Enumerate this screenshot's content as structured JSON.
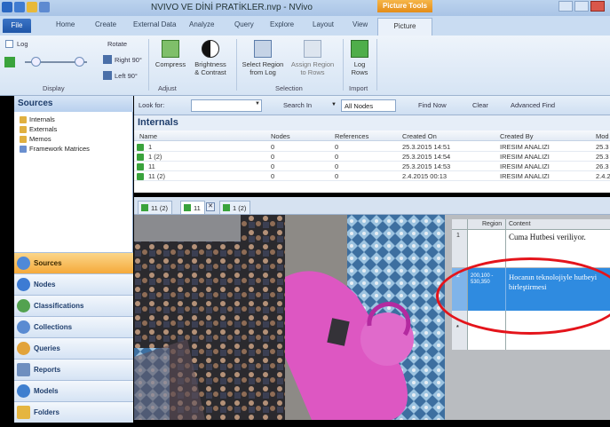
{
  "window": {
    "title": "NVIVO VE DİNİ PRATİKLER.nvp - NVivo",
    "contextual_tab": "Picture Tools"
  },
  "ribbon_tabs": [
    "File",
    "Home",
    "Create",
    "External Data",
    "Analyze",
    "Query",
    "Explore",
    "Layout",
    "View",
    "Picture"
  ],
  "ribbon": {
    "display": {
      "log_label": "Log",
      "rotate_label": "Rotate",
      "right90": "Right 90°",
      "left90": "Left 90°",
      "group": "Display"
    },
    "adjust": {
      "compress": "Compress",
      "brightness_1": "Brightness",
      "brightness_2": "& Contrast",
      "group": "Adjust"
    },
    "selection": {
      "select_region_1": "Select Region",
      "select_region_2": "from Log",
      "assign_region_1": "Assign Region",
      "assign_region_2": "to Rows",
      "group": "Selection"
    },
    "import": {
      "log_rows_1": "Log",
      "log_rows_2": "Rows",
      "group": "Import"
    }
  },
  "nav": {
    "header": "Sources",
    "tree": [
      "Internals",
      "Externals",
      "Memos",
      "Framework Matrices"
    ],
    "buttons": [
      "Sources",
      "Nodes",
      "Classifications",
      "Collections",
      "Queries",
      "Reports",
      "Models",
      "Folders"
    ]
  },
  "findbar": {
    "look_for": "Look for:",
    "search_in": "Search In",
    "scope": "All Nodes",
    "find_now": "Find Now",
    "clear": "Clear",
    "advanced": "Advanced Find"
  },
  "list": {
    "title": "Internals",
    "columns": [
      "Name",
      "Nodes",
      "References",
      "Created On",
      "Created By",
      "Mod"
    ],
    "rows": [
      {
        "name": "1",
        "nodes": "0",
        "refs": "0",
        "created_on": "25.3.2015 14:51",
        "created_by": "IRESIM ANALIZI",
        "mod": "25.3"
      },
      {
        "name": "1 (2)",
        "nodes": "0",
        "refs": "0",
        "created_on": "25.3.2015 14:54",
        "created_by": "IRESIM ANALIZI",
        "mod": "25.3"
      },
      {
        "name": "11",
        "nodes": "0",
        "refs": "0",
        "created_on": "25.3.2015 14:53",
        "created_by": "IRESIM ANALIZI",
        "mod": "26.3"
      },
      {
        "name": "11 (2)",
        "nodes": "0",
        "refs": "0",
        "created_on": "2.4.2015 00:13",
        "created_by": "IRESIM ANALIZI",
        "mod": "2.4.2"
      }
    ]
  },
  "doc_tabs": [
    "11 (2)",
    "11",
    "1 (2)"
  ],
  "region_log": {
    "col_region": "Region",
    "col_content": "Content",
    "rows": [
      {
        "num": "1",
        "region": "",
        "content": "Cuma Hutbesi veriliyor."
      },
      {
        "num": "2",
        "region": "200,100 - 530,350",
        "content": "Hocanın teknolojiyle hutbeyi birleştirmesi"
      },
      {
        "num": "*",
        "region": "",
        "content": ""
      }
    ]
  },
  "colors": {
    "accent": "#2f8be0",
    "active_nav": "#f5a93a",
    "annotation": "#e4141b"
  }
}
